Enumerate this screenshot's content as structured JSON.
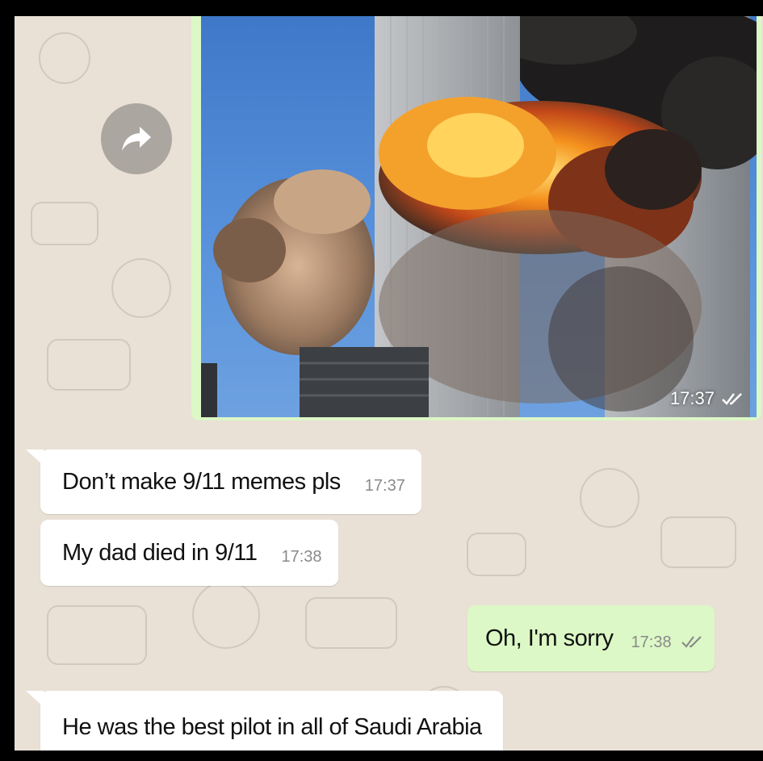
{
  "colors": {
    "chat_background": "#e9e1d6",
    "incoming_bubble": "#ffffff",
    "outgoing_bubble": "#dcf8c6",
    "timestamp": "#8a8a8a",
    "read_check": "#4a90d9"
  },
  "forward_button": {
    "icon": "forward-arrow-icon"
  },
  "image_message": {
    "direction": "outgoing",
    "content": "photo",
    "time": "17:37",
    "status_icon": "double-check-icon"
  },
  "messages": [
    {
      "direction": "incoming",
      "text": "Don’t make 9/11 memes pls",
      "time": "17:37"
    },
    {
      "direction": "incoming",
      "text": "My dad died in 9/11",
      "time": "17:38"
    },
    {
      "direction": "outgoing",
      "text": "Oh, I'm sorry",
      "time": "17:38",
      "status_icon": "double-check-icon"
    },
    {
      "direction": "incoming",
      "text": "He was the best pilot in all of Saudi Arabia"
    }
  ]
}
